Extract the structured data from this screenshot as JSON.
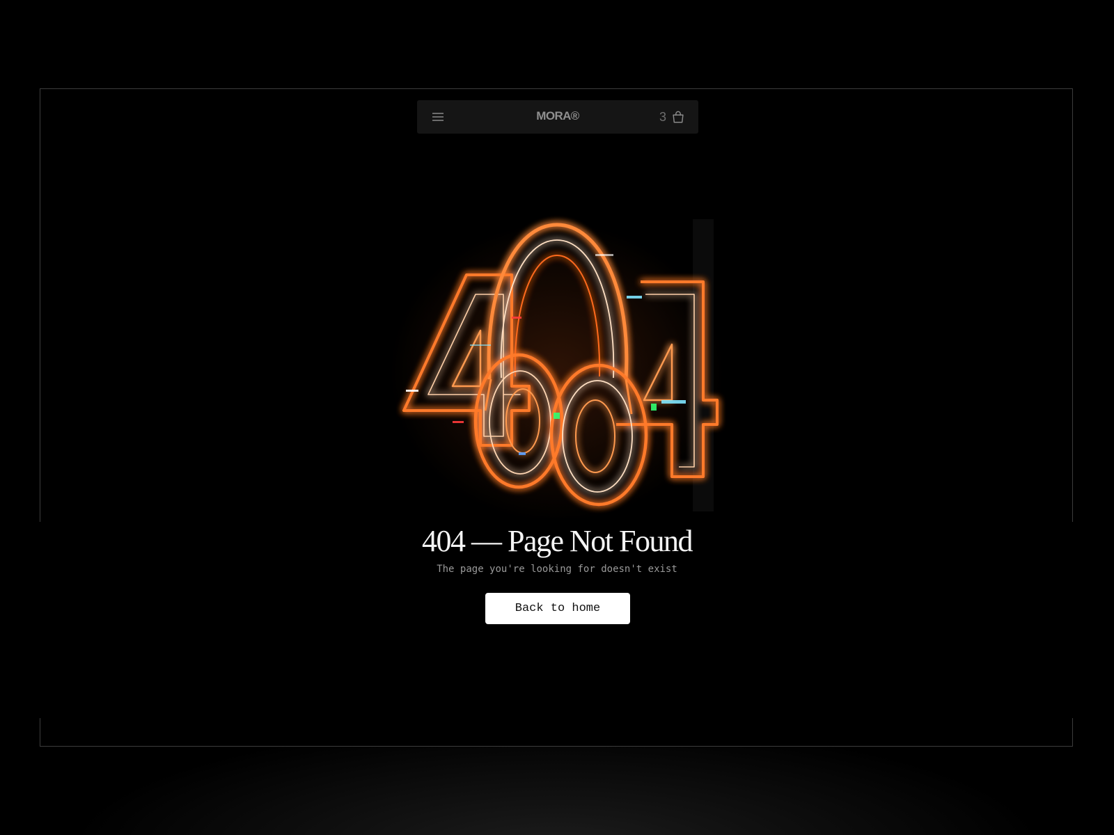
{
  "header": {
    "brand": "MORA®",
    "cart_count": "3",
    "menu_icon": "hamburger-menu-icon",
    "cart_icon": "shopping-bag-icon"
  },
  "hero": {
    "illustration_text": "404",
    "illustration_icon": "neon-headphones-icon",
    "glow_color": "#ff7a2a",
    "glitch_color": "#7fe6ff"
  },
  "error": {
    "title": "404 — Page Not Found",
    "message": "The page you're looking for doesn't exist",
    "button_label": "Back to home"
  },
  "colors": {
    "background": "#000000",
    "navbar": "#151515",
    "frame_border": "#3c3c3c",
    "button_bg": "#ffffff",
    "button_text": "#111111"
  }
}
